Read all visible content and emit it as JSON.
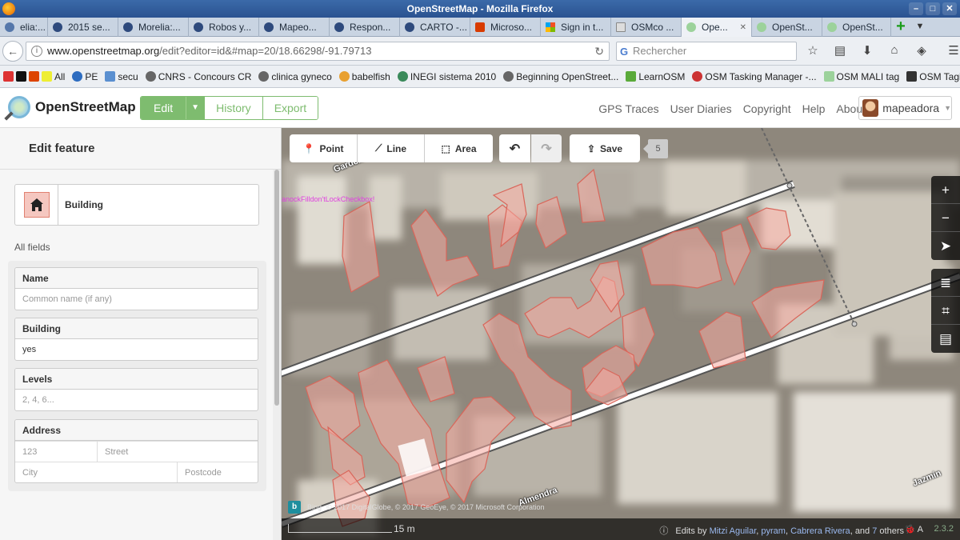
{
  "browser": {
    "title": "OpenStreetMap - Mozilla Firefox",
    "tabs": [
      {
        "label": "elia:...",
        "active": false
      },
      {
        "label": "2015 se...",
        "active": false
      },
      {
        "label": "Morelia:...",
        "active": false
      },
      {
        "label": "Robos y...",
        "active": false
      },
      {
        "label": "Mapeo...",
        "active": false
      },
      {
        "label": "Respon...",
        "active": false
      },
      {
        "label": "CARTO -...",
        "active": false
      },
      {
        "label": "Microso...",
        "active": false
      },
      {
        "label": "Sign in t...",
        "active": false
      },
      {
        "label": "OSMco ...",
        "active": false
      },
      {
        "label": "Ope...",
        "active": true
      },
      {
        "label": "OpenSt...",
        "active": false
      },
      {
        "label": "OpenSt...",
        "active": false
      }
    ],
    "url_host": "www.openstreetmap.org",
    "url_path": "/edit?editor=id&#map=20/18.66298/-91.79713",
    "search_placeholder": "Rechercher",
    "bookmarks": [
      "All",
      "PE",
      "secu",
      "CNRS - Concours CR",
      "clinica gyneco",
      "babelfish",
      "INEGI sistema 2010",
      "Beginning OpenStreet...",
      "LearnOSM",
      "OSM Tasking Manager -...",
      "OSM MALI tag",
      "OSM Taginfo"
    ]
  },
  "osm": {
    "brand": "OpenStreetMap",
    "edit_label": "Edit",
    "history_label": "History",
    "export_label": "Export",
    "nav": [
      "GPS Traces",
      "User Diaries",
      "Copyright",
      "Help",
      "About"
    ],
    "username": "mapeadora",
    "accent": "#7ebc6f"
  },
  "sidebar": {
    "title": "Edit feature",
    "preset_label": "Building",
    "all_fields": "All fields",
    "fields": {
      "name_label": "Name",
      "name_placeholder": "Common name (if any)",
      "building_label": "Building",
      "building_value": "yes",
      "levels_label": "Levels",
      "levels_placeholder": "2, 4, 6...",
      "address_label": "Address",
      "housenumber_placeholder": "123",
      "street_placeholder": "Street",
      "city_placeholder": "City",
      "postcode_placeholder": "Postcode"
    }
  },
  "map": {
    "tools": {
      "point": "Point",
      "line": "Line",
      "area": "Area",
      "save": "Save"
    },
    "edit_count": "5",
    "lock_message": "anockFilldon'tLockCheckbox!",
    "streets": {
      "gardenia": "Gardenia",
      "almendra": "Almendra",
      "jazmin": "Jazmin"
    },
    "imagery": "Bing",
    "attribution": "© 2017 DigitalGlobe, © 2017 GeoEye, © 2017 Microsoft Corporation",
    "scale_label": "15 m",
    "contributors": {
      "prefix": "Edits by",
      "users": [
        "Mitzi Aguilar",
        "pyram",
        "Cabrera Rivera"
      ],
      "and": "and",
      "others_count": "7",
      "others": "others"
    },
    "version": "2.3.2"
  }
}
